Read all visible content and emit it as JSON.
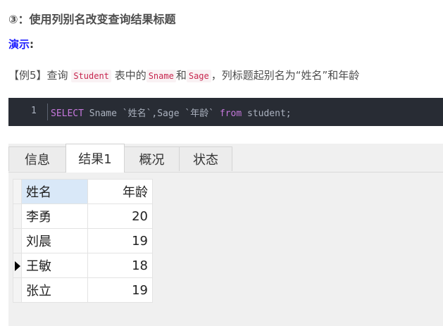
{
  "heading": "③：使用列别名改变查询结果标题",
  "demo": {
    "label": "演示",
    "colon": ":"
  },
  "example": {
    "prefix": "【例5】查询",
    "code_table": "Student",
    "text_table_mid": "表中的",
    "code_col1": "Sname",
    "text_and": "和",
    "code_col2": "Sage",
    "suffix": "，列标题起别名为“姓名”和年龄"
  },
  "code_block": {
    "line_number": "1",
    "kw_select": "SELECT",
    "part1": " Sname `姓名`,Sage `年龄` ",
    "kw_from": "from",
    "part2": " student;"
  },
  "tabs": [
    {
      "label": "信息",
      "active": false
    },
    {
      "label": "结果1",
      "active": true
    },
    {
      "label": "概况",
      "active": false
    },
    {
      "label": "状态",
      "active": false
    }
  ],
  "result_table": {
    "columns": [
      "姓名",
      "年龄"
    ],
    "rows": [
      {
        "name": "李勇",
        "age": "20",
        "current": false
      },
      {
        "name": "刘晨",
        "age": "19",
        "current": false
      },
      {
        "name": "王敏",
        "age": "18",
        "current": true
      },
      {
        "name": "张立",
        "age": "19",
        "current": false
      }
    ]
  }
}
